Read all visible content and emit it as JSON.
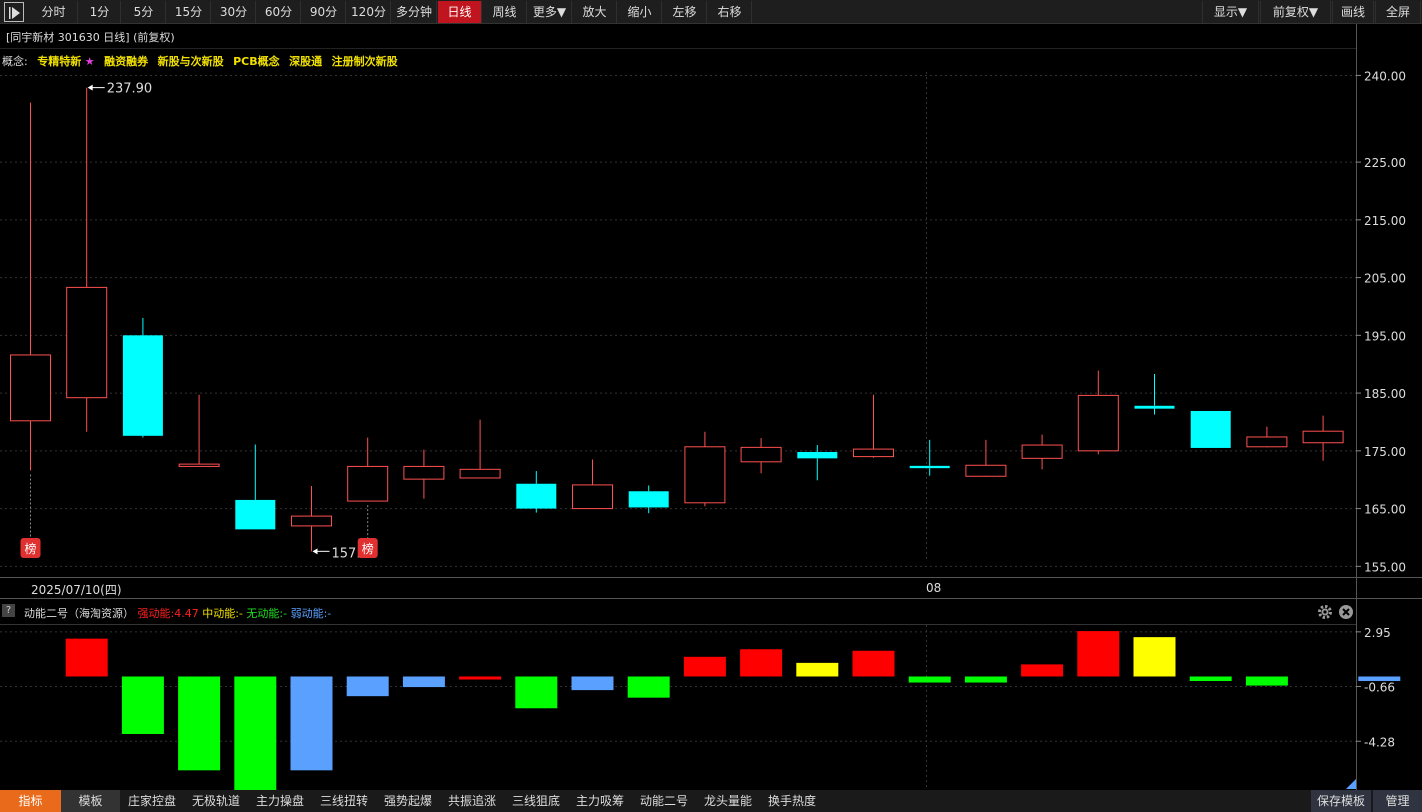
{
  "toolbar": {
    "buttons": [
      "分时",
      "1分",
      "5分",
      "15分",
      "30分",
      "60分",
      "90分",
      "120分",
      "多分钟",
      "日线",
      "周线",
      "更多▼",
      "放大",
      "缩小",
      "左移",
      "右移"
    ],
    "active": "日线",
    "right_buttons": [
      "显示▼",
      "前复权▼",
      "画线",
      "全屏"
    ]
  },
  "header": {
    "title": "[同宇新材 301630 日线]  (前复权)",
    "concept_label": "概念:",
    "concepts": [
      "专精特新",
      "融资融券",
      "新股与次新股",
      "PCB概念",
      "深股通",
      "注册制次新股"
    ],
    "star": "★"
  },
  "chart": {
    "high_label": "237.90",
    "low_label": "157.",
    "badge": "榜",
    "date_label": "2025/07/10(四)",
    "mid_axis_label": "08"
  },
  "indicator": {
    "help": "?",
    "name": "动能二号（海淘资源）",
    "strong": "强动能:4.47",
    "mid": "中动能:-",
    "none": "无动能:-",
    "weak": "弱动能:-"
  },
  "bottom_bar": {
    "tabs": [
      "指标",
      "模板",
      "庄家控盘",
      "无极轨道",
      "主力操盘",
      "三线扭转",
      "强势起爆",
      "共振追涨",
      "三线狙底",
      "主力吸筹",
      "动能二号",
      "龙头量能",
      "换手热度"
    ],
    "save": "保存模板",
    "manage": "管理"
  },
  "chart_data": [
    {
      "type": "candlestick",
      "title": "同宇新材 301630 日线",
      "y_axis_ticks": [
        240,
        225,
        215,
        205,
        195,
        185,
        175,
        165,
        155
      ],
      "y_axis_labels": [
        "240.00",
        "225.00",
        "215.00",
        "205.00",
        "195.00",
        "185.00",
        "175.00",
        "165.00",
        "155.00"
      ],
      "ylim": [
        153.5,
        242.5
      ],
      "candles": [
        {
          "open": 180.2,
          "close": 191.6,
          "high": 235.3,
          "low": 171.6,
          "dir": "up"
        },
        {
          "open": 184.2,
          "close": 203.3,
          "high": 237.9,
          "low": 178.3,
          "dir": "up"
        },
        {
          "open": 195.0,
          "close": 177.6,
          "high": 198.0,
          "low": 177.3,
          "dir": "down"
        },
        {
          "open": 172.3,
          "close": 172.7,
          "high": 184.7,
          "low": 172.3,
          "dir": "up"
        },
        {
          "open": 166.5,
          "close": 161.4,
          "high": 176.1,
          "low": 161.4,
          "dir": "down"
        },
        {
          "open": 162.0,
          "close": 163.7,
          "high": 168.9,
          "low": 157.6,
          "dir": "up"
        },
        {
          "open": 166.3,
          "close": 172.3,
          "high": 177.3,
          "low": 166.3,
          "dir": "up"
        },
        {
          "open": 170.1,
          "close": 172.3,
          "high": 175.2,
          "low": 166.7,
          "dir": "up"
        },
        {
          "open": 170.3,
          "close": 171.8,
          "high": 180.4,
          "low": 170.3,
          "dir": "up"
        },
        {
          "open": 169.3,
          "close": 165.0,
          "high": 171.5,
          "low": 164.3,
          "dir": "down"
        },
        {
          "open": 165.0,
          "close": 169.1,
          "high": 173.5,
          "low": 165.0,
          "dir": "up"
        },
        {
          "open": 168.0,
          "close": 165.2,
          "high": 169.0,
          "low": 164.2,
          "dir": "down"
        },
        {
          "open": 166.0,
          "close": 175.7,
          "high": 178.3,
          "low": 165.4,
          "dir": "up"
        },
        {
          "open": 173.1,
          "close": 175.6,
          "high": 177.2,
          "low": 171.1,
          "dir": "up"
        },
        {
          "open": 174.8,
          "close": 173.7,
          "high": 176.0,
          "low": 169.9,
          "dir": "down"
        },
        {
          "open": 174.0,
          "close": 175.3,
          "high": 184.7,
          "low": 173.8,
          "dir": "up"
        },
        {
          "open": 172.4,
          "close": 172.0,
          "high": 176.9,
          "low": 170.7,
          "dir": "down"
        },
        {
          "open": 170.6,
          "close": 172.5,
          "high": 176.9,
          "low": 170.5,
          "dir": "up"
        },
        {
          "open": 173.7,
          "close": 176.0,
          "high": 177.8,
          "low": 171.8,
          "dir": "up"
        },
        {
          "open": 175.0,
          "close": 184.6,
          "high": 188.9,
          "low": 174.4,
          "dir": "up"
        },
        {
          "open": 182.8,
          "close": 182.3,
          "high": 188.3,
          "low": 181.3,
          "dir": "down"
        },
        {
          "open": 181.9,
          "close": 175.5,
          "high": 181.9,
          "low": 175.5,
          "dir": "down"
        },
        {
          "open": 175.7,
          "close": 177.4,
          "high": 179.2,
          "low": 175.6,
          "dir": "up"
        },
        {
          "open": 176.4,
          "close": 178.4,
          "high": 181.1,
          "low": 173.3,
          "dir": "up"
        }
      ]
    },
    {
      "type": "bar",
      "title": "动能二号（海淘资源）",
      "y_axis_ticks": [
        2.95,
        -0.66,
        -4.28
      ],
      "y_axis_labels": [
        "2.95",
        "-0.66",
        "-4.28"
      ],
      "ylim": [
        -7.5,
        3.6
      ],
      "values": [
        2.5,
        -3.8,
        -6.2,
        -7.5,
        -6.2,
        -1.3,
        -0.7,
        -0.2,
        -2.1,
        -0.9,
        -1.4,
        1.3,
        1.8,
        0.9,
        1.7,
        -0.4,
        -0.4,
        0.8,
        3.0,
        2.6,
        -0.3,
        -0.6,
        0,
        -0.3
      ],
      "colors": [
        "red",
        "green",
        "green",
        "green",
        "blue",
        "blue",
        "blue",
        "red",
        "green",
        "blue",
        "green",
        "red",
        "red",
        "yellow",
        "red",
        "green",
        "green",
        "red",
        "red",
        "yellow",
        "green",
        "green",
        "blank",
        "blue"
      ],
      "palette": {
        "red": "#ff0000",
        "green": "#00ff00",
        "blue": "#5aa0ff",
        "yellow": "#ffff00",
        "blank": "#000000"
      }
    }
  ],
  "colors": {
    "up": "#ff5050",
    "down": "#00ffff",
    "active_tab": "#c0141e",
    "axis_text": "#dddddd"
  }
}
